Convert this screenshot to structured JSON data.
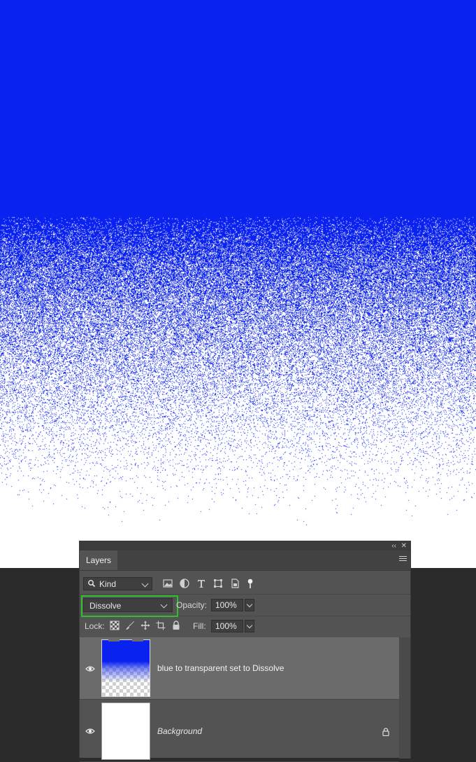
{
  "document": {
    "gradient_color": "#0a22f0",
    "background_color": "#ffffff"
  },
  "layers_panel": {
    "collapse_glyph": "‹‹",
    "close_glyph": "✕",
    "tab_label": "Layers",
    "filter": {
      "kind_label": "Kind",
      "icons": [
        "image-filter-icon",
        "adjustment-filter-icon",
        "type-filter-icon",
        "shape-filter-icon",
        "smart-object-filter-icon",
        "filter-toggle-icon"
      ]
    },
    "blend_mode": "Dissolve",
    "opacity_label": "Opacity:",
    "opacity_value": "100%",
    "lock_label": "Lock:",
    "lock_icons": [
      "lock-transparent-pixels-icon",
      "lock-image-pixels-icon",
      "lock-position-icon",
      "lock-artboard-icon",
      "lock-all-icon"
    ],
    "fill_label": "Fill:",
    "fill_value": "100%",
    "highlight_color": "#2fc02f",
    "layers": [
      {
        "name": "blue to transparent set to Dissolve",
        "visible": true,
        "selected": true,
        "italic": false
      },
      {
        "name": "Background",
        "visible": true,
        "selected": false,
        "italic": true,
        "locked": true
      }
    ]
  }
}
